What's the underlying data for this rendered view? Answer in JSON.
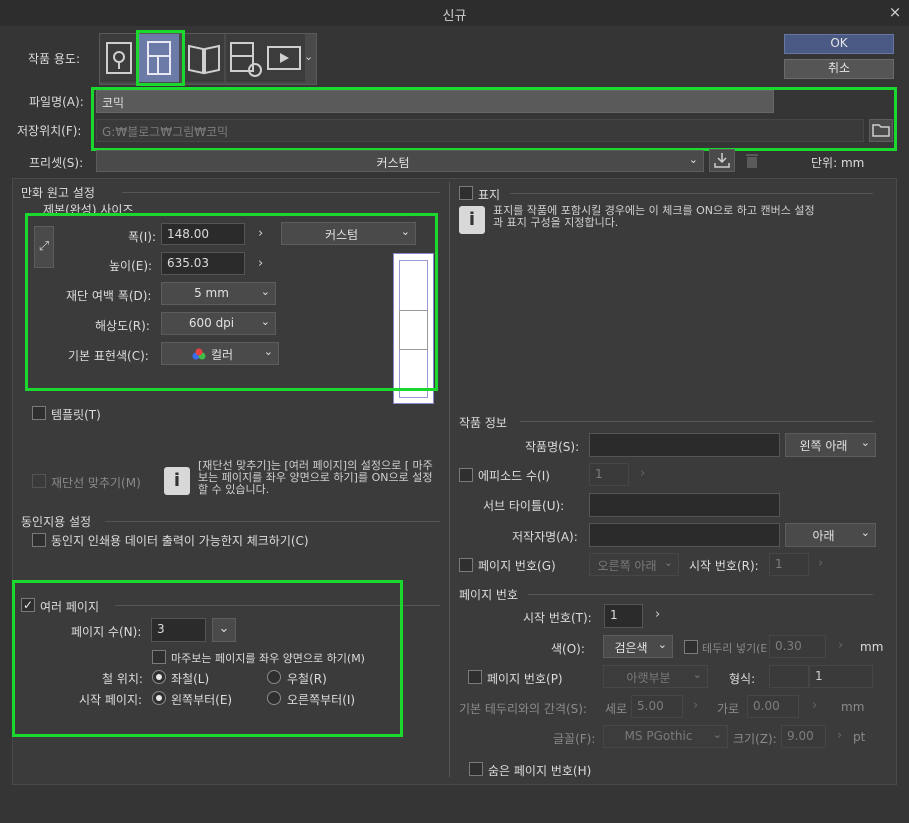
{
  "window": {
    "title": "신규",
    "close": "×"
  },
  "usage": {
    "label": "작품 용도:",
    "icons": [
      "illustration-icon",
      "comic-icon",
      "book-icon",
      "animation-settings-icon",
      "animation-icon"
    ],
    "more": "⌄"
  },
  "buttons": {
    "ok": "OK",
    "cancel": "취소"
  },
  "file": {
    "name_label": "파일명(A):",
    "name_value": "코믹",
    "save_label": "저장위치(F):",
    "save_value": "G:₩블로그₩그림₩코믹"
  },
  "preset": {
    "label": "프리셋(S):",
    "value": "커스텀",
    "unit": "단위: mm"
  },
  "manga": {
    "section": "만화 원고 설정",
    "subsection": "제본(완성) 사이즈",
    "width_label": "폭(I):",
    "width_value": "148.00",
    "size_preset": "커스텀",
    "height_label": "높이(E):",
    "height_value": "635.03",
    "bleed_label": "재단 여백 폭(D):",
    "bleed_value": "5 mm",
    "res_label": "해상도(R):",
    "res_value": "600 dpi",
    "color_label": "기본 표현색(C):",
    "color_value": "컬러",
    "template": "템플릿(T)",
    "align_label": "재단선 맞추기(M)",
    "align_info": "[재단선 맞추기]는 [여러 페이지]의 설정으로 [ 마주보는 페이지를 좌우 양면으로 하기]를 ON으로 설정할 수 있습니다."
  },
  "doujin": {
    "section": "동인지용 설정",
    "check": "동인지 인쇄용 데이터 출력이 가능한지 체크하기(C)"
  },
  "multi": {
    "label": "여러 페이지",
    "checked": true,
    "count_label": "페이지 수(N):",
    "count_value": "3",
    "spread": "마주보는 페이지를 좌우 양면으로 하기(M)",
    "bind_label": "철 위치:",
    "bind_left": "좌철(L)",
    "bind_right": "우철(R)",
    "start_label": "시작 페이지:",
    "start_left": "왼쪽부터(E)",
    "start_right": "오른쪽부터(I)"
  },
  "cover": {
    "label": "표지",
    "info": "표지를 작품에 포함시킬 경우에는 이 체크를 ON으로 하고 캔버스 설정과 표지 구성을 지정합니다."
  },
  "work": {
    "section": "작품 정보",
    "title_label": "작품명(S):",
    "title_pos": "왼쪽 아래",
    "episode_label": "에피소드 수(I)",
    "episode_value": "1",
    "subtitle_label": "서브 타이틀(U):",
    "author_label": "저작자명(A):",
    "author_pos": "아래",
    "pagenum_label": "페이지 번호(G)",
    "pagenum_pos": "오른쪽 아래",
    "start_label": "시작 번호(R):",
    "start_value": "1"
  },
  "pagenum": {
    "section": "페이지 번호",
    "start_label": "시작 번호(T):",
    "start_value": "1",
    "color_label": "색(O):",
    "color_value": "검은색",
    "border_label": "테두리 넣기(E",
    "border_value": "0.30",
    "border_unit": "mm",
    "pagecheck": "페이지 번호(P)",
    "place_value": "아랫부분",
    "format_label": "형식:",
    "format_value": "1",
    "gap_label": "기본 테두리와의 간격(S):",
    "vert_label": "세로",
    "vert_value": "5.00",
    "horiz_label": "가로",
    "horiz_value": "0.00",
    "gap_unit": "mm",
    "font_label": "글꼴(F):",
    "font_value": "MS PGothic",
    "size_label": "크기(Z):",
    "size_value": "9.00",
    "size_unit": "pt",
    "hidden": "숨은 페이지 번호(H)"
  }
}
